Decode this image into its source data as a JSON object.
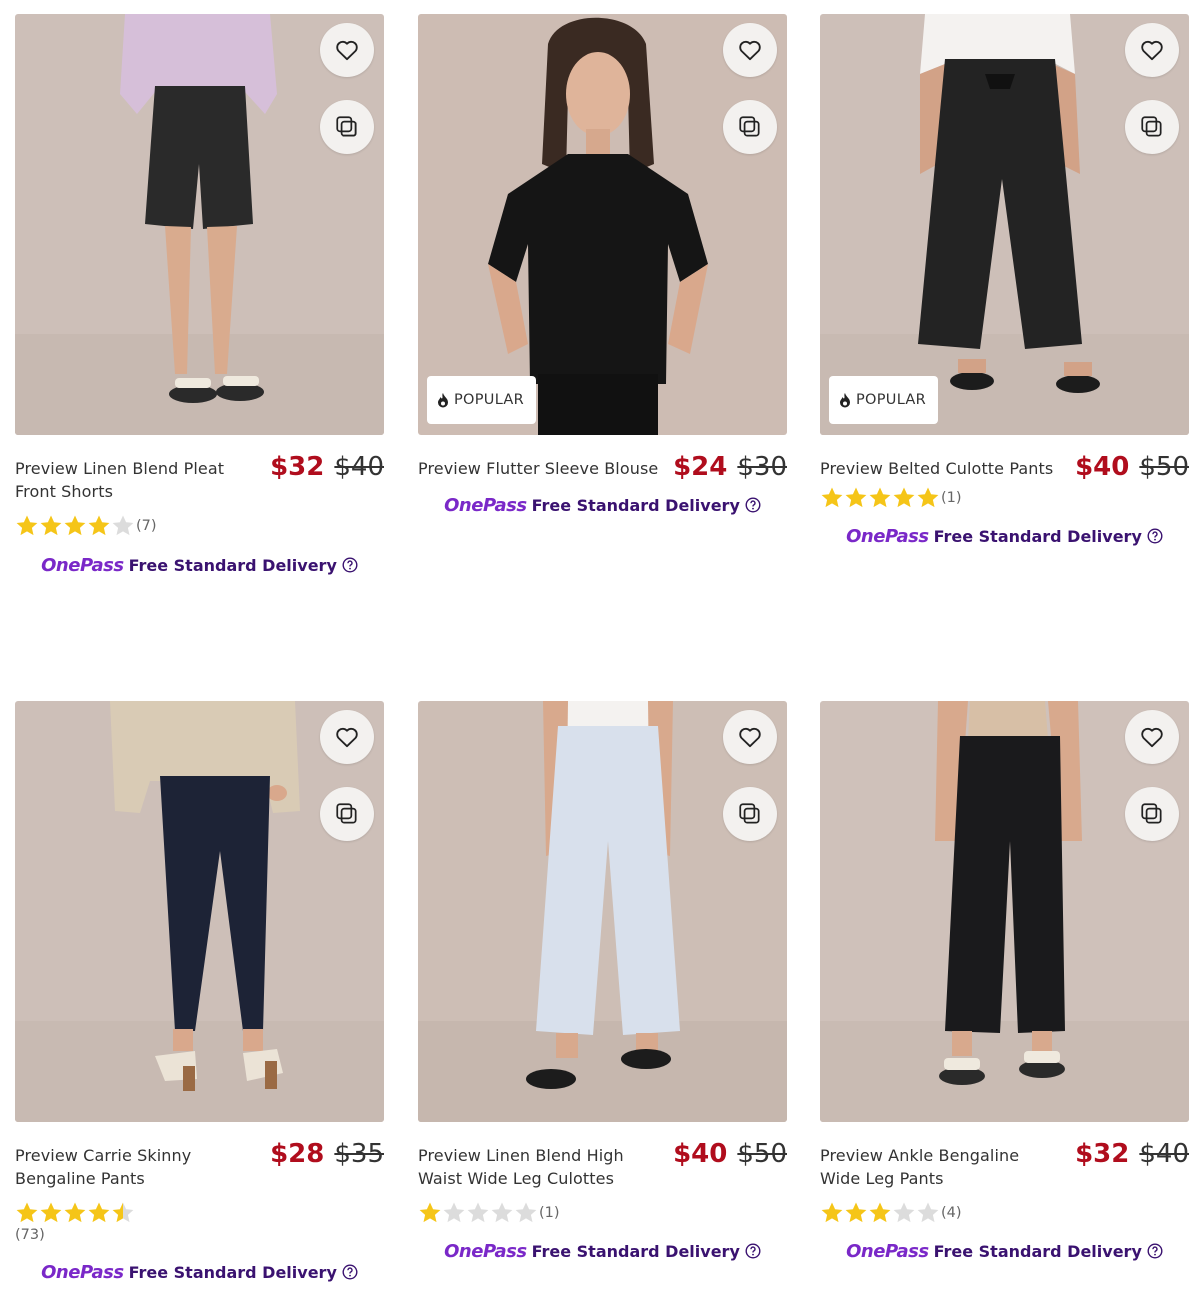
{
  "colors": {
    "price_red": "#b00d1d",
    "onepass_purple": "#7a28c8",
    "delivery_text": "#3a1270",
    "star_gold": "#f5c518",
    "star_empty": "#dcdcdc"
  },
  "common": {
    "popular_label": "POPULAR",
    "onepass_label": "OnePass",
    "delivery_label": "Free Standard Delivery"
  },
  "products": [
    {
      "name": "Preview Linen Blend Pleat Front Shorts",
      "price": "$32",
      "was": "$40",
      "rating": 4,
      "count": "(7)",
      "popular": false
    },
    {
      "name": "Preview Flutter Sleeve Blouse",
      "price": "$24",
      "was": "$30",
      "rating": null,
      "count": "",
      "popular": true
    },
    {
      "name": "Preview Belted Culotte Pants",
      "price": "$40",
      "was": "$50",
      "rating": 5,
      "count": "(1)",
      "popular": true
    },
    {
      "name": "Preview Carrie Skinny Bengaline Pants",
      "price": "$28",
      "was": "$35",
      "rating": 4.5,
      "count": "(73)",
      "popular": false
    },
    {
      "name": "Preview Linen Blend High Waist Wide Leg Culottes",
      "price": "$40",
      "was": "$50",
      "rating": 1,
      "count": "(1)",
      "popular": false
    },
    {
      "name": "Preview Ankle Bengaline Wide Leg Pants",
      "price": "$32",
      "was": "$40",
      "rating": 3,
      "count": "(4)",
      "popular": false
    }
  ],
  "icons": {
    "favourite": "heart-icon",
    "compare": "compare-icon",
    "popular": "flame-icon",
    "help": "help-circle-icon"
  }
}
